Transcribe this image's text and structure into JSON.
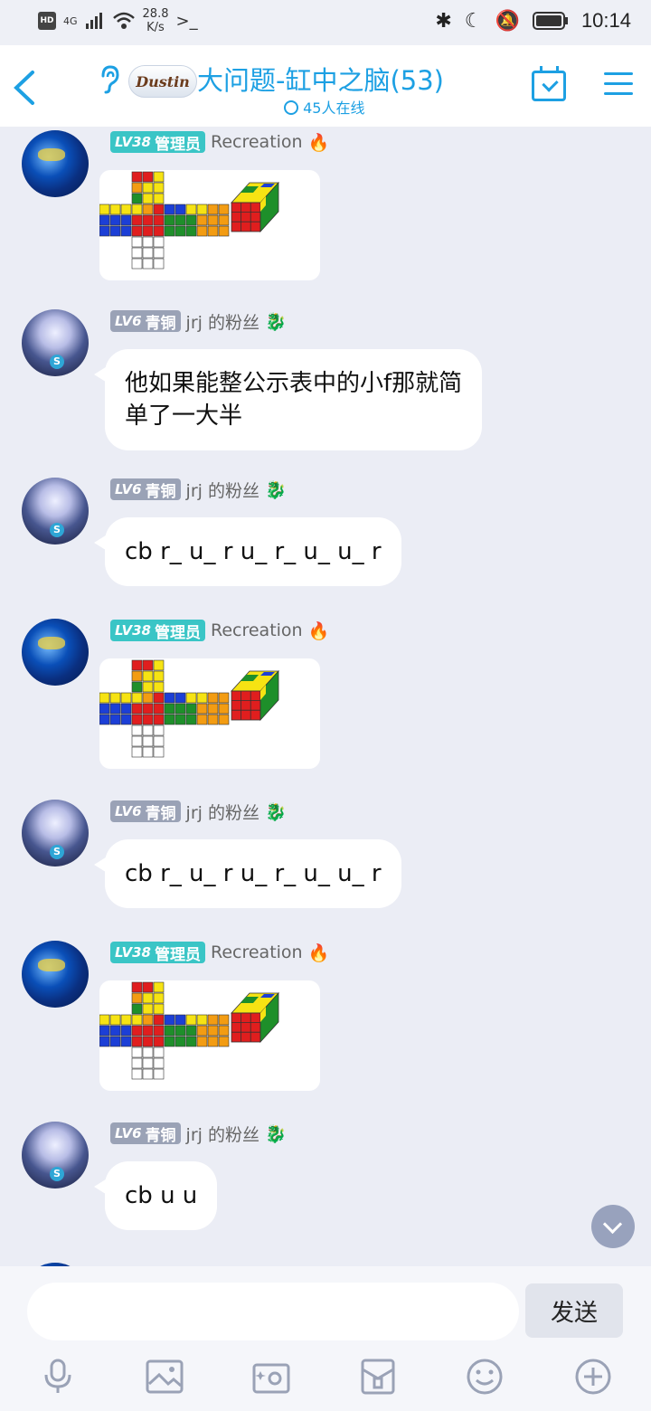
{
  "status_bar": {
    "hd": "HD",
    "net": "4G",
    "speed_value": "28.8",
    "speed_unit": "K/s",
    "prompt": ">_",
    "time": "10:14"
  },
  "header": {
    "back_label": "<",
    "logo_text": "Dustin",
    "title": "大问题-缸中之脑(53)",
    "online": "45人在线"
  },
  "messages": [
    {
      "avatar": "blue-globe-avatar",
      "level": "LV38",
      "role": "管理员",
      "name": "Recreation",
      "suffix": "🔥",
      "type": "image"
    },
    {
      "avatar": "anime-avatar",
      "level": "LV6",
      "role": "青铜",
      "name": "jrj 的粉丝",
      "suffix": "🐉",
      "type": "text",
      "text_line1": "他如果能整公示表中的小f那就简",
      "text_line2": "单了一大半"
    },
    {
      "avatar": "anime-avatar",
      "level": "LV6",
      "role": "青铜",
      "name": "jrj 的粉丝",
      "suffix": "🐉",
      "type": "text",
      "text_line1": "cb r_ u_ r u_ r_ u_ u_ r"
    },
    {
      "avatar": "blue-globe-avatar",
      "level": "LV38",
      "role": "管理员",
      "name": "Recreation",
      "suffix": "🔥",
      "type": "image"
    },
    {
      "avatar": "anime-avatar",
      "level": "LV6",
      "role": "青铜",
      "name": "jrj 的粉丝",
      "suffix": "🐉",
      "type": "text",
      "text_line1": "cb r_ u_ r u_ r_ u_ u_ r"
    },
    {
      "avatar": "blue-globe-avatar",
      "level": "LV38",
      "role": "管理员",
      "name": "Recreation",
      "suffix": "🔥",
      "type": "image"
    },
    {
      "avatar": "anime-avatar",
      "level": "LV6",
      "role": "青铜",
      "name": "jrj 的粉丝",
      "suffix": "🐉",
      "type": "text",
      "text_line1": "cb u u"
    }
  ],
  "composer": {
    "placeholder": "",
    "send_label": "发送"
  },
  "toolbar": [
    "microphone-icon",
    "picture-icon",
    "camera-icon",
    "box-icon",
    "emoji-icon",
    "plus-icon"
  ],
  "colors": {
    "accent": "#1da0e3",
    "admin_badge": "#3ac5c6",
    "bronze_badge": "#9aa2b6",
    "background": "#ebedf5"
  }
}
